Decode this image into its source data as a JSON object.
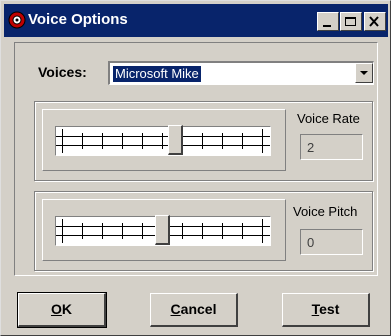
{
  "window": {
    "title": "Voice Options",
    "icon": "app-icon",
    "controls": [
      "minimize-icon",
      "maximize-icon",
      "close-icon"
    ]
  },
  "voices": {
    "label": "Voices:",
    "selected": "Microsoft Mike"
  },
  "voice_rate": {
    "label": "Voice Rate",
    "value": "2",
    "level": 0.57
  },
  "voice_pitch": {
    "label": "Voice Pitch",
    "value": "0",
    "level": 0.5
  },
  "buttons": {
    "ok_first": "O",
    "ok_rest": "K",
    "cancel_first": "C",
    "cancel_rest": "ancel",
    "test_first": "T",
    "test_rest": "est"
  },
  "colors": {
    "titlebar": "#08246b",
    "face": "#d4d0c8",
    "selection": "#08246b"
  }
}
